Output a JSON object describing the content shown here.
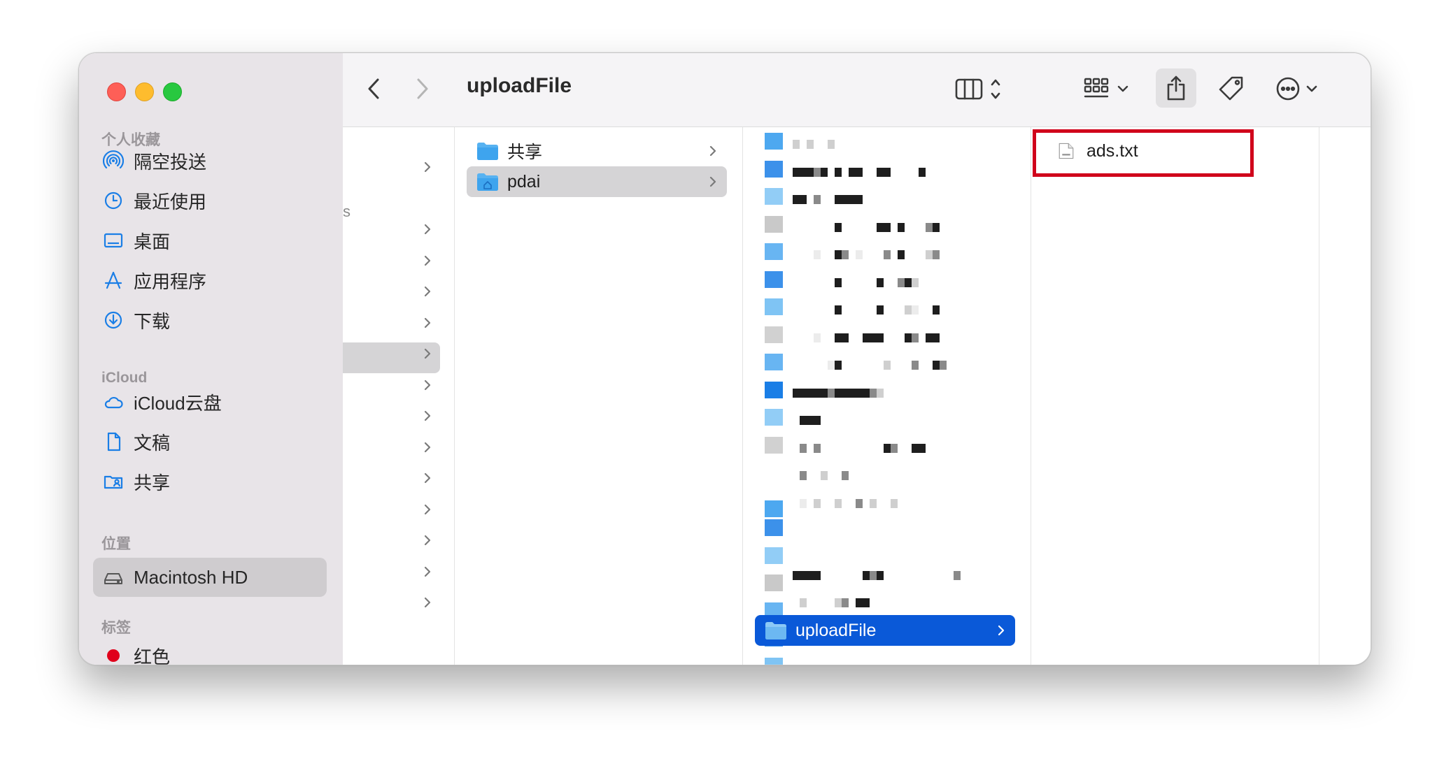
{
  "window": {
    "title": "uploadFile"
  },
  "sidebar": {
    "favorites_heading": "个人收藏",
    "favorites": [
      {
        "label": "隔空投送",
        "icon": "airdrop-icon"
      },
      {
        "label": "最近使用",
        "icon": "clock-icon"
      },
      {
        "label": "桌面",
        "icon": "desktop-icon"
      },
      {
        "label": "应用程序",
        "icon": "applications-icon"
      },
      {
        "label": "下载",
        "icon": "download-icon"
      }
    ],
    "icloud_heading": "iCloud",
    "icloud": [
      {
        "label": "iCloud云盘",
        "icon": "cloud-icon"
      },
      {
        "label": "文稿",
        "icon": "document-icon"
      },
      {
        "label": "共享",
        "icon": "shared-folder-icon"
      }
    ],
    "locations_heading": "位置",
    "locations": [
      {
        "label": "Macintosh HD",
        "icon": "harddisk-icon",
        "selected": true
      }
    ],
    "tags_heading": "标签",
    "tags": [
      {
        "label": "红色",
        "color": "#e0001b"
      }
    ]
  },
  "toolbar": {
    "back": "chevron-left-icon",
    "forward": "chevron-right-icon",
    "view_mode": "columns-view-icon",
    "group": "grid-group-icon",
    "share": "share-icon",
    "tag": "tag-icon",
    "more": "ellipsis-circle-icon",
    "search": "search-icon"
  },
  "column1": {
    "fragment": "s",
    "chevron_count": 14
  },
  "column2": {
    "items": [
      {
        "label": "共享",
        "icon": "folder-icon"
      },
      {
        "label": "pdai",
        "icon": "home-folder-icon",
        "selected": true
      }
    ]
  },
  "column3": {
    "selected_label": "uploadFile",
    "pixelated_rows": 20,
    "redacted_blocks": [
      [
        0,
        0,
        1
      ],
      [
        2,
        0,
        1
      ],
      [
        5,
        0,
        1
      ],
      [
        0,
        1,
        3
      ],
      [
        1,
        1,
        3
      ],
      [
        2,
        1,
        3
      ],
      [
        3,
        1,
        2
      ],
      [
        4,
        1,
        3
      ],
      [
        6,
        1,
        3
      ],
      [
        8,
        1,
        3
      ],
      [
        9,
        1,
        3
      ],
      [
        12,
        1,
        3
      ],
      [
        13,
        1,
        3
      ],
      [
        18,
        1,
        3
      ],
      [
        0,
        2,
        3
      ],
      [
        1,
        2,
        3
      ],
      [
        3,
        2,
        2
      ],
      [
        6,
        2,
        3
      ],
      [
        7,
        2,
        3
      ],
      [
        8,
        2,
        3
      ],
      [
        9,
        2,
        3
      ],
      [
        6,
        3,
        3
      ],
      [
        12,
        3,
        3
      ],
      [
        13,
        3,
        3
      ],
      [
        15,
        3,
        3
      ],
      [
        19,
        3,
        2
      ],
      [
        20,
        3,
        3
      ],
      [
        3,
        4,
        0
      ],
      [
        6,
        4,
        3
      ],
      [
        7,
        4,
        2
      ],
      [
        9,
        4,
        0
      ],
      [
        13,
        4,
        2
      ],
      [
        15,
        4,
        3
      ],
      [
        19,
        4,
        1
      ],
      [
        20,
        4,
        2
      ],
      [
        6,
        5,
        3
      ],
      [
        12,
        5,
        3
      ],
      [
        15,
        5,
        2
      ],
      [
        16,
        5,
        3
      ],
      [
        17,
        5,
        1
      ],
      [
        6,
        6,
        3
      ],
      [
        12,
        6,
        3
      ],
      [
        16,
        6,
        1
      ],
      [
        17,
        6,
        0
      ],
      [
        20,
        6,
        3
      ],
      [
        3,
        7,
        0
      ],
      [
        6,
        7,
        3
      ],
      [
        7,
        7,
        3
      ],
      [
        10,
        7,
        3
      ],
      [
        11,
        7,
        3
      ],
      [
        12,
        7,
        3
      ],
      [
        16,
        7,
        3
      ],
      [
        17,
        7,
        2
      ],
      [
        19,
        7,
        3
      ],
      [
        20,
        7,
        3
      ],
      [
        5,
        8,
        0
      ],
      [
        6,
        8,
        3
      ],
      [
        13,
        8,
        1
      ],
      [
        17,
        8,
        2
      ],
      [
        20,
        8,
        3
      ],
      [
        21,
        8,
        2
      ],
      [
        0,
        9,
        3
      ],
      [
        1,
        9,
        3
      ],
      [
        2,
        9,
        3
      ],
      [
        3,
        9,
        3
      ],
      [
        4,
        9,
        3
      ],
      [
        5,
        9,
        2
      ],
      [
        6,
        9,
        3
      ],
      [
        7,
        9,
        3
      ],
      [
        8,
        9,
        3
      ],
      [
        9,
        9,
        3
      ],
      [
        10,
        9,
        3
      ],
      [
        11,
        9,
        2
      ],
      [
        12,
        9,
        1
      ],
      [
        1,
        10,
        3
      ],
      [
        2,
        10,
        3
      ],
      [
        3,
        10,
        3
      ],
      [
        1,
        11,
        2
      ],
      [
        3,
        11,
        2
      ],
      [
        13,
        11,
        3
      ],
      [
        14,
        11,
        2
      ],
      [
        17,
        11,
        3
      ],
      [
        18,
        11,
        3
      ],
      [
        1,
        12,
        2
      ],
      [
        4,
        12,
        1
      ],
      [
        7,
        12,
        2
      ],
      [
        1,
        13,
        0
      ],
      [
        3,
        13,
        1
      ],
      [
        6,
        13,
        1
      ],
      [
        9,
        13,
        2
      ],
      [
        11,
        13,
        1
      ],
      [
        14,
        13,
        1
      ],
      [
        0,
        15,
        3
      ],
      [
        1,
        15,
        3
      ],
      [
        2,
        15,
        3
      ],
      [
        3,
        15,
        3
      ],
      [
        10,
        15,
        3
      ],
      [
        11,
        15,
        2
      ],
      [
        12,
        15,
        3
      ],
      [
        23,
        15,
        2
      ],
      [
        1,
        16,
        1
      ],
      [
        6,
        16,
        1
      ],
      [
        7,
        16,
        2
      ],
      [
        9,
        16,
        3
      ],
      [
        10,
        16,
        3
      ]
    ],
    "redacted_shades": [
      "#ececec",
      "#cfcfcf",
      "#8a8a8a",
      "#1e1e1e"
    ]
  },
  "column4": {
    "items": [
      {
        "label": "ads.txt",
        "icon": "text-file-icon"
      }
    ]
  },
  "annotation": {
    "color": "#d0021b"
  }
}
